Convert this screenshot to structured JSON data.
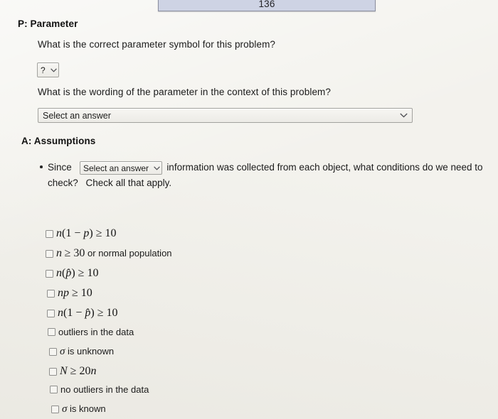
{
  "top_field": {
    "value": "136"
  },
  "parameter_section": {
    "heading": "P: Parameter",
    "symbol_prompt": "What is the correct parameter symbol for this problem?",
    "symbol_select_value": "?",
    "wording_prompt": "What is the wording of the parameter in the context of this problem?",
    "wording_select_value": "Select an answer"
  },
  "assumptions_section": {
    "heading": "A: Assumptions",
    "bullet": {
      "text_before_select": "Since",
      "select_value": "Select an answer",
      "text_after_select": "information was collected from each object, what conditions do we need to",
      "line2_a": "check?",
      "line2_b": "Check all that apply."
    },
    "checkboxes": [
      {
        "label": "n(1 − p) ≥ 10",
        "kind": "math",
        "checked": false
      },
      {
        "label": "n ≥ 30 or normal population",
        "kind": "mixed",
        "checked": false
      },
      {
        "label": "n(p̂) ≥ 10",
        "kind": "math",
        "checked": false
      },
      {
        "label": "np ≥ 10",
        "kind": "math",
        "checked": false
      },
      {
        "label": "n(1 − p̂) ≥ 10",
        "kind": "math",
        "checked": false
      },
      {
        "label": "outliers in the data",
        "kind": "text",
        "checked": false
      },
      {
        "label": "σ is unknown",
        "kind": "mixed",
        "checked": false
      },
      {
        "label": "N ≥ 20n",
        "kind": "math",
        "checked": false
      },
      {
        "label": "no outliers in the data",
        "kind": "text",
        "checked": false
      },
      {
        "label": "σ is known",
        "kind": "mixed",
        "checked": false
      }
    ]
  },
  "colors": {
    "page_background": "#f3f2ed",
    "top_box_fill": "#ced3e4",
    "top_box_border": "#8c90a0",
    "select_border": "#a2a29e",
    "text": "#1b1b1b"
  }
}
